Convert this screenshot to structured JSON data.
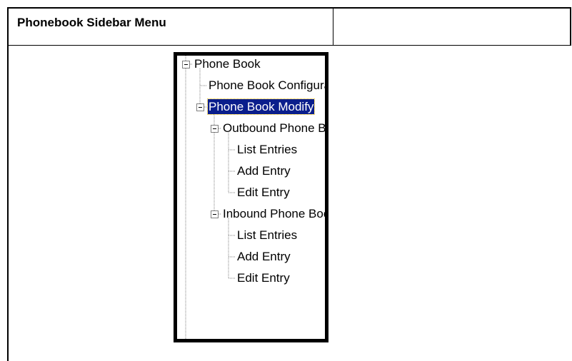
{
  "header": {
    "title": "Phonebook Sidebar Menu"
  },
  "tree": {
    "selected": "Phone Book Modify",
    "nodes": [
      {
        "label": "Phone Book",
        "level": 0,
        "expandable": true,
        "expanded": true
      },
      {
        "label": "Phone Book Configuration",
        "level": 1,
        "expandable": false
      },
      {
        "label": "Phone Book Modify",
        "level": 1,
        "expandable": true,
        "expanded": true,
        "selected": true
      },
      {
        "label": "Outbound Phone Book",
        "level": 2,
        "expandable": true,
        "expanded": true
      },
      {
        "label": "List Entries",
        "level": 3,
        "expandable": false
      },
      {
        "label": "Add Entry",
        "level": 3,
        "expandable": false
      },
      {
        "label": "Edit Entry",
        "level": 3,
        "expandable": false
      },
      {
        "label": "Inbound Phone Book",
        "level": 2,
        "expandable": true,
        "expanded": true
      },
      {
        "label": "List Entries",
        "level": 3,
        "expandable": false
      },
      {
        "label": "Add Entry",
        "level": 3,
        "expandable": false
      },
      {
        "label": "Edit Entry",
        "level": 3,
        "expandable": false
      }
    ]
  },
  "colors": {
    "selection_bg": "#0a1e8c",
    "selection_text": "#ffffff",
    "tree_lines": "#808080"
  }
}
